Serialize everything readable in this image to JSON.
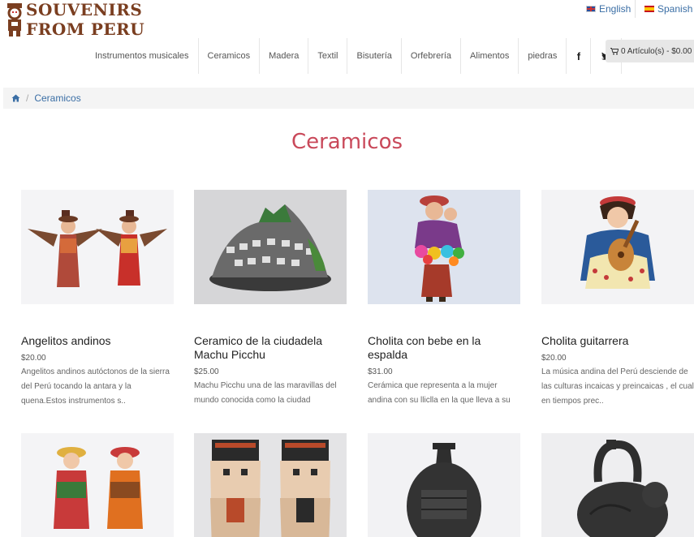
{
  "brand": {
    "line1": "SOUVENIRS",
    "line2": "FROM PERU"
  },
  "languages": [
    {
      "label": "English",
      "flag": "uk-flag-icon"
    },
    {
      "label": "Spanish",
      "flag": "es-flag-icon"
    }
  ],
  "nav": {
    "items": [
      "Instrumentos musicales",
      "Ceramicos",
      "Madera",
      "Textil",
      "Bisutería",
      "Orfebrería",
      "Alimentos",
      "piedras"
    ],
    "social": [
      {
        "icon": "facebook-icon",
        "glyph": "f"
      },
      {
        "icon": "twitter-icon"
      }
    ]
  },
  "cart": {
    "label": "0 Artículo(s) - $0.00"
  },
  "breadcrumb": {
    "current": "Ceramicos"
  },
  "page": {
    "title": "Ceramicos"
  },
  "products": [
    {
      "name": "Angelitos andinos",
      "price": "$20.00",
      "desc": "Angelitos andinos autóctonos de la sierra del Perú tocando la antara y la quena.Estos instrumentos s.."
    },
    {
      "name": "Ceramico de la ciudadela Machu Picchu",
      "price": "$25.00",
      "desc": "Machu Picchu una de las maravillas del mundo conocida como la ciudad"
    },
    {
      "name": "Cholita con bebe en la espalda",
      "price": "$31.00",
      "desc": "Cerámica que representa a la mujer andina con su lliclla en la que lleva a su"
    },
    {
      "name": "Cholita guitarrera",
      "price": "$20.00",
      "desc": "La música andina del Perú desciende de las culturas incaicas y preincaicas , el cual en tiempos prec.."
    }
  ],
  "colors": {
    "title": "#c9495a",
    "link": "#3a6ea5",
    "brand": "#7a3e20"
  }
}
